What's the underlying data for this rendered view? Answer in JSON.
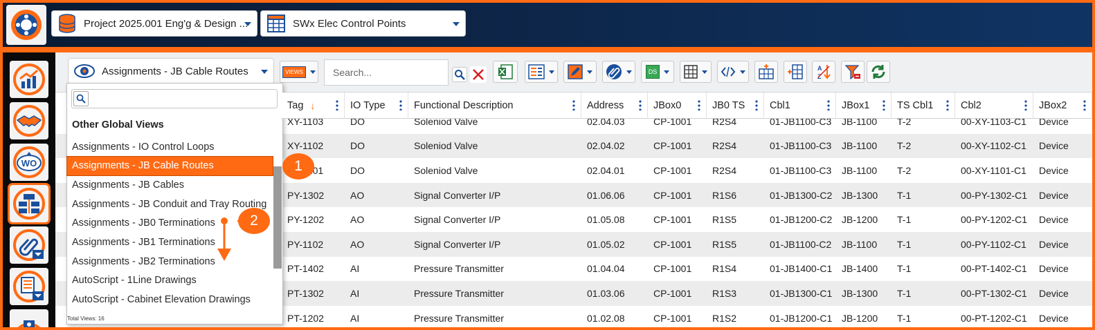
{
  "top_bar": {
    "project_combo": "Project 2025.001 Eng'g & Design ...",
    "table_combo": "SWx Elec Control Points"
  },
  "toolbar": {
    "view_combo": "Assignments - JB Cable Routes",
    "views_button": "VIEWS",
    "search_placeholder": "Search...",
    "ds_button": "DS"
  },
  "grid": {
    "columns": [
      "Tag",
      "IO Type",
      "Functional Description",
      "Address",
      "JBox0",
      "JB0 TS",
      "Cbl1",
      "JBox1",
      "TS Cbl1",
      "Cbl2",
      "JBox2"
    ],
    "sort_indicator": "↓",
    "rows": [
      [
        "XY-1103",
        "DO",
        "Soleniod Valve",
        "02.04.03",
        "CP-1001",
        "R2S4",
        "01-JB1100-C3",
        "JB-1100",
        "T-2",
        "00-XY-1103-C1",
        "Device"
      ],
      [
        "XY-1102",
        "DO",
        "Soleniod Valve",
        "02.04.02",
        "CP-1001",
        "R2S4",
        "01-JB1100-C3",
        "JB-1100",
        "T-2",
        "00-XY-1102-C1",
        "Device"
      ],
      [
        "XY-1101",
        "DO",
        "Soleniod Valve",
        "02.04.01",
        "CP-1001",
        "R2S4",
        "01-JB1100-C3",
        "JB-1100",
        "T-2",
        "00-XY-1101-C1",
        "Device"
      ],
      [
        "PY-1302",
        "AO",
        "Signal Converter I/P",
        "01.06.06",
        "CP-1001",
        "R1S6",
        "01-JB1300-C2",
        "JB-1300",
        "T-1",
        "00-PY-1302-C1",
        "Device"
      ],
      [
        "PY-1202",
        "AO",
        "Signal Converter I/P",
        "01.05.08",
        "CP-1001",
        "R1S5",
        "01-JB1200-C2",
        "JB-1200",
        "T-1",
        "00-PY-1202-C1",
        "Device"
      ],
      [
        "PY-1102",
        "AO",
        "Signal Converter I/P",
        "01.05.02",
        "CP-1001",
        "R1S5",
        "01-JB1100-C2",
        "JB-1100",
        "T-1",
        "00-PY-1102-C1",
        "Device"
      ],
      [
        "PT-1402",
        "AI",
        "Pressure Transmitter",
        "01.04.04",
        "CP-1001",
        "R1S4",
        "01-JB1400-C1",
        "JB-1400",
        "T-1",
        "00-PT-1402-C1",
        "Device"
      ],
      [
        "PT-1302",
        "AI",
        "Pressure Transmitter",
        "01.03.06",
        "CP-1001",
        "R1S3",
        "01-JB1300-C1",
        "JB-1300",
        "T-1",
        "00-PT-1302-C1",
        "Device"
      ],
      [
        "PT-1202",
        "AI",
        "Pressure Transmitter",
        "01.02.08",
        "CP-1001",
        "R1S2",
        "01-JB1200-C1",
        "JB-1200",
        "T-1",
        "00-PT-1202-C1",
        "Device"
      ]
    ]
  },
  "dropdown": {
    "group_label": "Other Global Views",
    "items": [
      "Assignments - IO Control Loops",
      "Assignments - JB Cable Routes",
      "Assignments - JB Cables",
      "Assignments - JB Conduit and Tray Routing",
      "Assignments - JB0 Terminations",
      "Assignments - JB1 Terminations",
      "Assignments - JB2 Terminations",
      "AutoScript - 1Line Drawings",
      "AutoScript - Cabinet Elevation Drawings"
    ],
    "selected_index": 1,
    "footer": "Total Views: 16"
  },
  "callouts": [
    "1",
    "2"
  ],
  "colors": {
    "accent": "#ff6a13",
    "brand_blue": "#1a4f9c",
    "navy": "#0b1e3a"
  }
}
